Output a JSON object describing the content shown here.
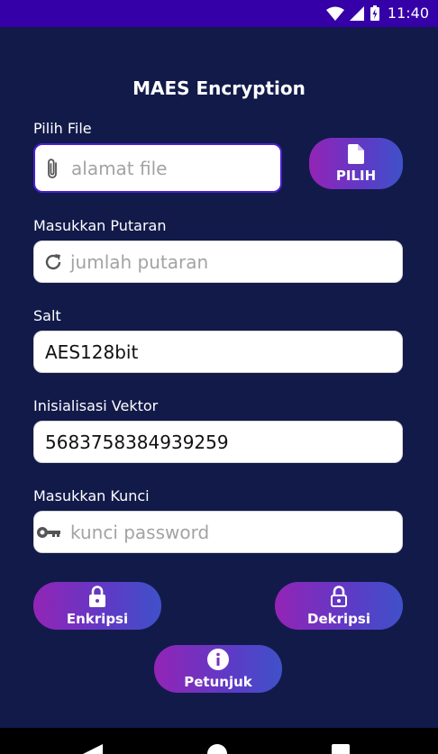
{
  "status_bar": {
    "time": "11:40"
  },
  "app": {
    "title": "MAES Encryption"
  },
  "file": {
    "label": "Pilih File",
    "placeholder": "alamat file",
    "button_label": "PILIH"
  },
  "rounds": {
    "label": "Masukkan Putaran",
    "placeholder": "jumlah putaran"
  },
  "salt": {
    "label": "Salt",
    "value": "AES128bit"
  },
  "iv": {
    "label": "Inisialisasi Vektor",
    "value": "5683758384939259"
  },
  "key": {
    "label": "Masukkan Kunci",
    "placeholder": "kunci password"
  },
  "actions": {
    "encrypt_label": "Enkripsi",
    "decrypt_label": "Dekripsi",
    "help_label": "Petunjuk"
  },
  "colors": {
    "background": "#121a4a",
    "status_bar": "#3500a8",
    "button_gradient_start": "#9324b6",
    "button_gradient_end": "#3f51c9"
  }
}
